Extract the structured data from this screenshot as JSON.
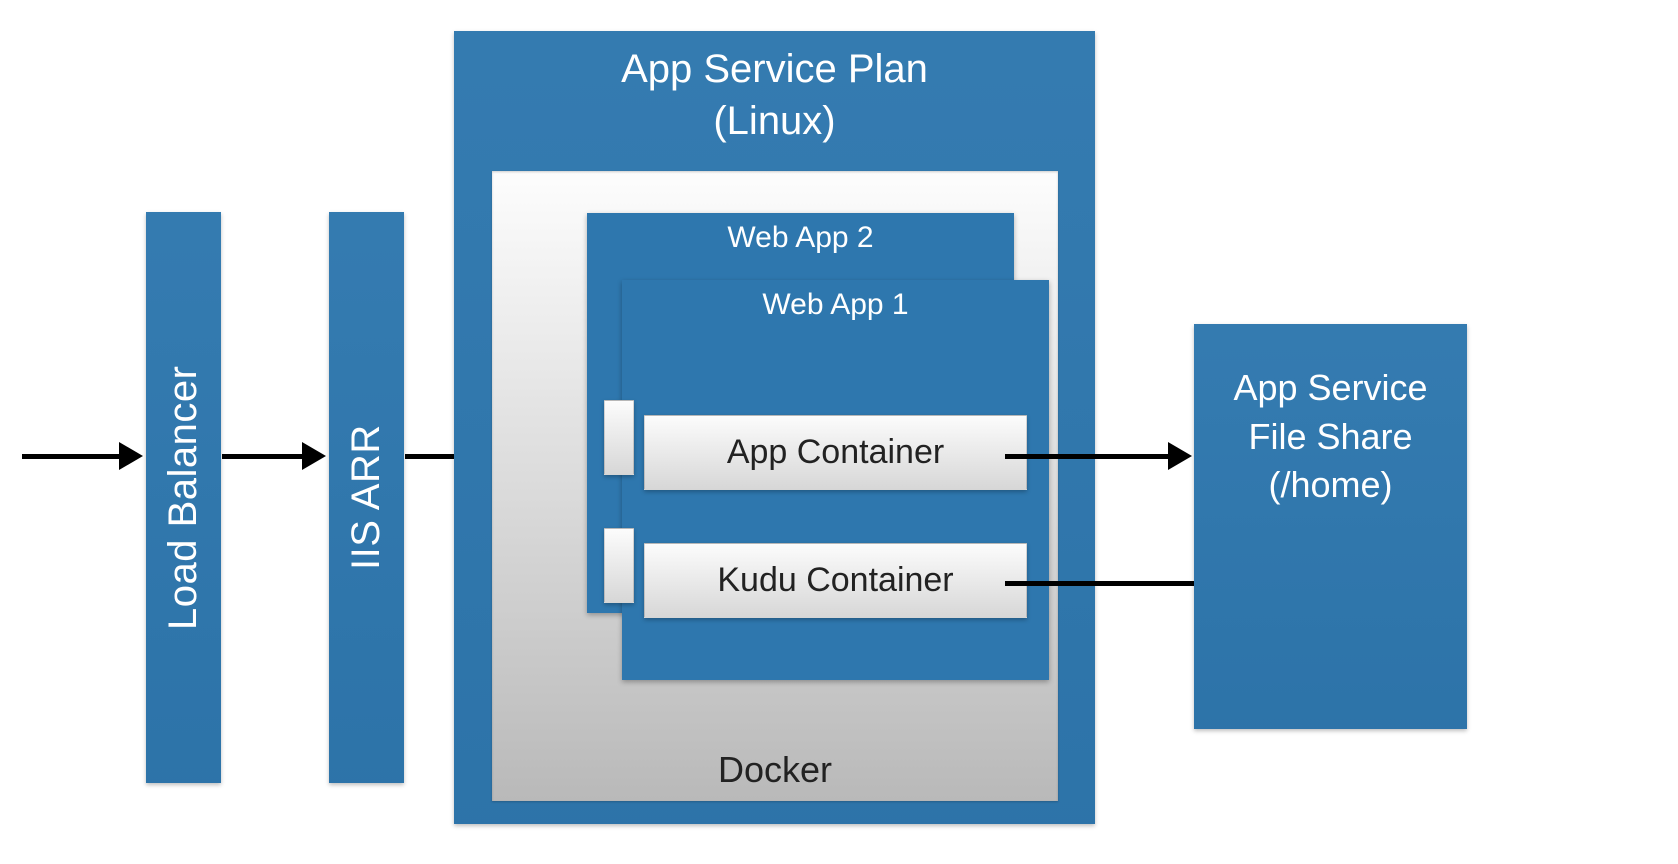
{
  "load_balancer": {
    "label": "Load Balancer"
  },
  "iis_arr": {
    "label": "IIS ARR"
  },
  "app_service_plan": {
    "title_line1": "App Service Plan",
    "title_line2": "(Linux)",
    "docker_label": "Docker",
    "webapp2_label": "Web App 2",
    "webapp1_label": "Web App 1",
    "app_container_label": "App Container",
    "kudu_container_label": "Kudu Container"
  },
  "file_share": {
    "line1": "App Service",
    "line2": "File Share",
    "line3": "(/home)"
  }
}
